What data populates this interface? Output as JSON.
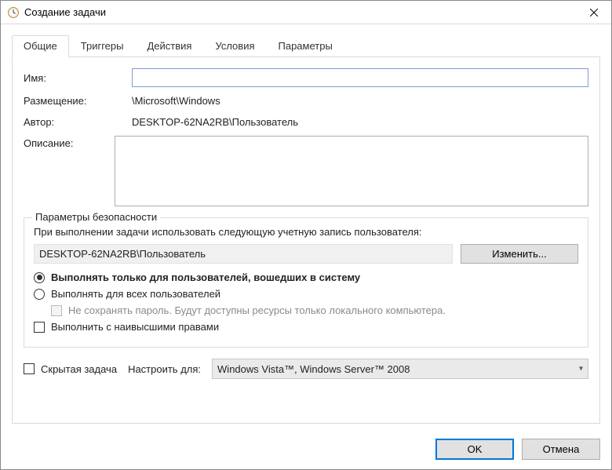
{
  "titlebar": {
    "title": "Создание задачи"
  },
  "tabs": {
    "general": "Общие",
    "triggers": "Триггеры",
    "actions": "Действия",
    "conditions": "Условия",
    "settings": "Параметры"
  },
  "general": {
    "name_label": "Имя:",
    "name_value": "",
    "location_label": "Размещение:",
    "location_value": "\\Microsoft\\Windows",
    "author_label": "Автор:",
    "author_value": "DESKTOP-62NA2RB\\Пользователь",
    "description_label": "Описание:",
    "description_value": ""
  },
  "security": {
    "legend": "Параметры безопасности",
    "run_as_text": "При выполнении задачи использовать следующую учетную запись пользователя:",
    "account": "DESKTOP-62NA2RB\\Пользователь",
    "change_button": "Изменить...",
    "radio_logged_on": "Выполнять только для пользователей, вошедших в систему",
    "radio_any_user": "Выполнять для всех пользователей",
    "no_store_password": "Не сохранять пароль. Будут доступны ресурсы только локального компьютера.",
    "highest_priv": "Выполнить с наивысшими правами"
  },
  "bottom": {
    "hidden_task": "Скрытая задача",
    "configure_for_label": "Настроить для:",
    "configure_for_value": "Windows Vista™, Windows Server™ 2008"
  },
  "buttons": {
    "ok": "OK",
    "cancel": "Отмена"
  }
}
